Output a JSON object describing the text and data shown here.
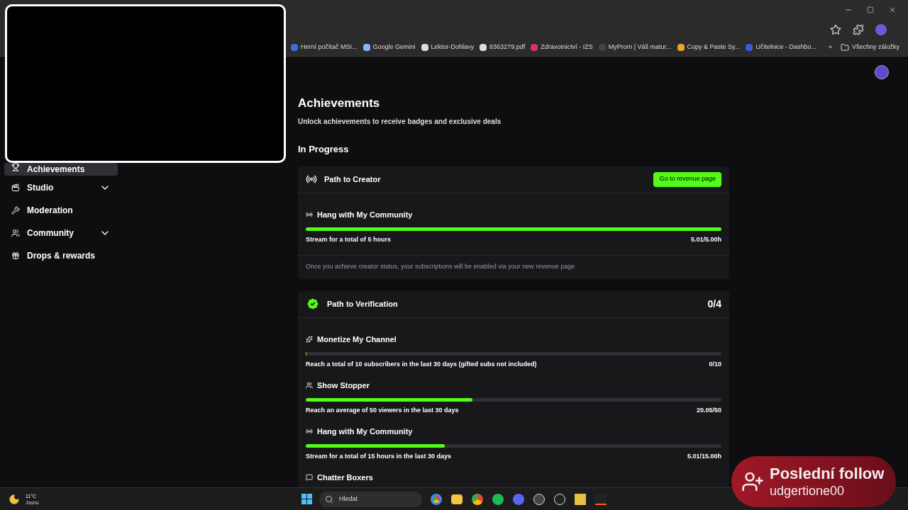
{
  "bookmarks": [
    {
      "label": "Herní počítač MSI...",
      "color": "#3b6fd6"
    },
    {
      "label": "Google Gemini",
      "color": "#8ab4f8"
    },
    {
      "label": "Lektor-Dohlavy",
      "color": "#dddddd"
    },
    {
      "label": "8363279.pdf",
      "color": "#dddddd"
    },
    {
      "label": "Zdravotnictví - IZS",
      "color": "#d6336c"
    },
    {
      "label": "MyProm | Váš matur...",
      "color": "#444444"
    },
    {
      "label": "Copy & Paste Sy...",
      "color": "#f0a030"
    },
    {
      "label": "Učitelnice - Dashbo...",
      "color": "#3b5bd6"
    }
  ],
  "bookmarks_more": "»",
  "bookmarks_folder": "Všechny záložky",
  "sidebar": [
    {
      "label": "Achievements",
      "kind": "trophy",
      "selected": true,
      "expandable": false
    },
    {
      "label": "Studio",
      "kind": "studio",
      "selected": false,
      "expandable": true
    },
    {
      "label": "Moderation",
      "kind": "wrench",
      "selected": false,
      "expandable": false
    },
    {
      "label": "Community",
      "kind": "users",
      "selected": false,
      "expandable": true
    },
    {
      "label": "Drops & rewards",
      "kind": "gift",
      "selected": false,
      "expandable": false
    }
  ],
  "page": {
    "title": "Achievements",
    "subtitle": "Unlock achievements to receive badges and exclusive deals",
    "section": "In Progress"
  },
  "cards": [
    {
      "title": "Path to Creator",
      "kind": "broadcast",
      "button": "Go to revenue page",
      "goals": [
        {
          "title": "Hang with My Community",
          "kind": "broadcast",
          "level": 1,
          "description": "Stream for a total of 5 hours",
          "reading": "5.01/5.00h"
        }
      ],
      "note": "Once you achieve creator status, your subscriptions will be enabled via your new revenue page"
    },
    {
      "title": "Path to Verification",
      "kind": "verified",
      "count": "0/4",
      "goals": [
        {
          "title": "Monetize My Channel",
          "kind": "sparkle",
          "level": 0,
          "description": "Reach a total of 10 subscribers in the last 30 days (gifted subs not included)",
          "reading": "0/10"
        },
        {
          "title": "Show Stopper",
          "kind": "users",
          "level": 0.401,
          "description": "Reach an average of 50 viewers in the last 30 days",
          "reading": "20.05/50"
        },
        {
          "title": "Hang with My Community",
          "kind": "broadcast",
          "level": 0.334,
          "description": "Stream for a total of 15 hours in the last 30 days",
          "reading": "5.01/15.00h"
        },
        {
          "title": "Chatter Boxers",
          "kind": "chat"
        }
      ]
    }
  ],
  "taskbar": {
    "temperature": "11°C",
    "condition": "Jasno",
    "search_placeholder": "Hledat"
  },
  "alert": {
    "title": "Poslední follow",
    "user": "udgertione00"
  }
}
